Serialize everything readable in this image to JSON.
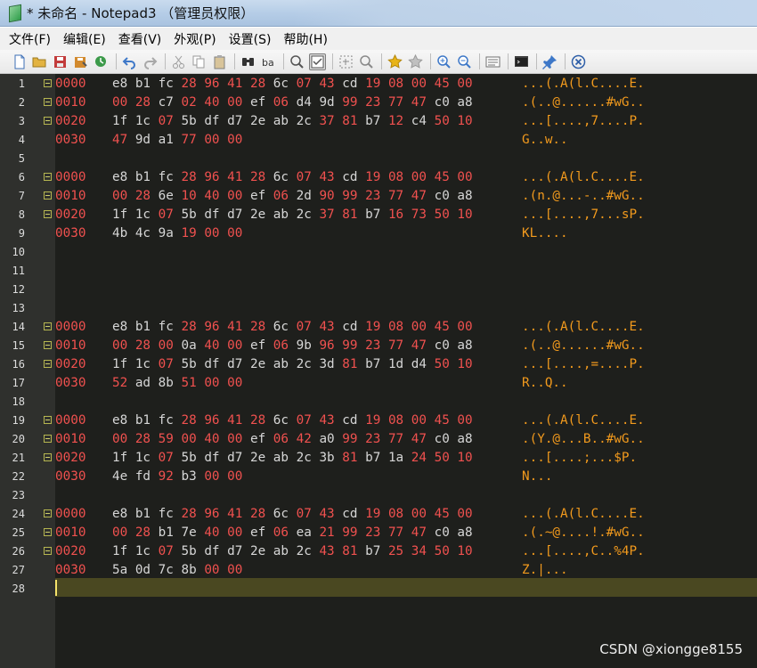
{
  "window": {
    "title": "* 未命名 - Notepad3 （管理员权限）"
  },
  "menu": [
    "文件(F)",
    "编辑(E)",
    "查看(V)",
    "外观(P)",
    "设置(S)",
    "帮助(H)"
  ],
  "toolbar": [
    {
      "name": "new-file-icon",
      "color": "#3d6fb6"
    },
    {
      "name": "open-folder-icon",
      "color": "#e3b341"
    },
    {
      "name": "save-icon",
      "color": "#c23b3b"
    },
    {
      "name": "save-as-icon",
      "color": "#d28a2e"
    },
    {
      "name": "browse-icon",
      "color": "#3c9a4a"
    },
    {
      "sep": true
    },
    {
      "name": "undo-icon",
      "color": "#3e78c8"
    },
    {
      "name": "redo-icon",
      "color": "#a8a8a8"
    },
    {
      "sep": true
    },
    {
      "name": "cut-icon",
      "color": "#9a9a9a"
    },
    {
      "name": "copy-icon",
      "color": "#9a9a9a"
    },
    {
      "name": "paste-icon",
      "color": "#7f7f7f"
    },
    {
      "sep": true
    },
    {
      "name": "find-icon",
      "color": "#333333"
    },
    {
      "name": "replace-icon",
      "color": "#333333"
    },
    {
      "sep": true
    },
    {
      "name": "goto-icon",
      "color": "#555555"
    },
    {
      "name": "word-wrap-icon",
      "color": "#555555",
      "pressed": true
    },
    {
      "sep": true
    },
    {
      "name": "select-icon",
      "color": "#8a8a8a"
    },
    {
      "name": "zoom-find-icon",
      "color": "#8a8a8a"
    },
    {
      "sep": true
    },
    {
      "name": "favorite-icon",
      "color": "#e8b417"
    },
    {
      "name": "add-favorite-icon",
      "color": "#c0c0c0"
    },
    {
      "sep": true
    },
    {
      "name": "zoom-in-icon",
      "color": "#3e78c8"
    },
    {
      "name": "zoom-out-icon",
      "color": "#3e78c8"
    },
    {
      "sep": true
    },
    {
      "name": "scheme-icon",
      "color": "#707070"
    },
    {
      "sep": true
    },
    {
      "name": "customize-icon",
      "color": "#404040"
    },
    {
      "sep": true
    },
    {
      "name": "pin-icon",
      "color": "#3e78c8"
    },
    {
      "sep": true
    },
    {
      "name": "exit-icon",
      "color": "#2f5fa8"
    }
  ],
  "editor": {
    "lines": [
      {
        "n": "1",
        "fold": true,
        "offset": "0000",
        "hex": "e8 b1 fc 28 96 41 28 6c 07 43 cd 19 08 00 45 00",
        "ascii": "...(.A(l.C....E."
      },
      {
        "n": "2",
        "fold": true,
        "offset": "0010",
        "hex": "00 28 c7 02 40 00 ef 06 d4 9d 99 23 77 47 c0 a8",
        "ascii": ".(..@......#wG.."
      },
      {
        "n": "3",
        "fold": true,
        "offset": "0020",
        "hex": "1f 1c 07 5b df d7 2e ab 2c 37 81 b7 12 c4 50 10",
        "ascii": "...[....,7....P."
      },
      {
        "n": "4",
        "fold": false,
        "offset": "0030",
        "hex": "47 9d a1 77 00 00",
        "ascii": "G..w.."
      },
      {
        "n": "5",
        "fold": false,
        "offset": "",
        "hex": "",
        "ascii": ""
      },
      {
        "n": "6",
        "fold": true,
        "offset": "0000",
        "hex": "e8 b1 fc 28 96 41 28 6c 07 43 cd 19 08 00 45 00",
        "ascii": "...(.A(l.C....E."
      },
      {
        "n": "7",
        "fold": true,
        "offset": "0010",
        "hex": "00 28 6e 10 40 00 ef 06 2d 90 99 23 77 47 c0 a8",
        "ascii": ".(n.@...-..#wG.."
      },
      {
        "n": "8",
        "fold": true,
        "offset": "0020",
        "hex": "1f 1c 07 5b df d7 2e ab 2c 37 81 b7 16 73 50 10",
        "ascii": "...[....,7...sP."
      },
      {
        "n": "9",
        "fold": false,
        "offset": "0030",
        "hex": "4b 4c 9a 19 00 00",
        "ascii": "KL...."
      },
      {
        "n": "10",
        "fold": false,
        "offset": "",
        "hex": "",
        "ascii": ""
      },
      {
        "n": "11",
        "fold": false,
        "offset": "",
        "hex": "",
        "ascii": ""
      },
      {
        "n": "12",
        "fold": false,
        "offset": "",
        "hex": "",
        "ascii": ""
      },
      {
        "n": "13",
        "fold": false,
        "offset": "",
        "hex": "",
        "ascii": ""
      },
      {
        "n": "14",
        "fold": true,
        "offset": "0000",
        "hex": "e8 b1 fc 28 96 41 28 6c 07 43 cd 19 08 00 45 00",
        "ascii": "...(.A(l.C....E."
      },
      {
        "n": "15",
        "fold": true,
        "offset": "0010",
        "hex": "00 28 00 0a 40 00 ef 06 9b 96 99 23 77 47 c0 a8",
        "ascii": ".(..@......#wG.."
      },
      {
        "n": "16",
        "fold": true,
        "offset": "0020",
        "hex": "1f 1c 07 5b df d7 2e ab 2c 3d 81 b7 1d d4 50 10",
        "ascii": "...[....,=....P."
      },
      {
        "n": "17",
        "fold": false,
        "offset": "0030",
        "hex": "52 ad 8b 51 00 00",
        "ascii": "R..Q.."
      },
      {
        "n": "18",
        "fold": false,
        "offset": "",
        "hex": "",
        "ascii": ""
      },
      {
        "n": "19",
        "fold": true,
        "offset": "0000",
        "hex": "e8 b1 fc 28 96 41 28 6c 07 43 cd 19 08 00 45 00",
        "ascii": "...(.A(l.C....E."
      },
      {
        "n": "20",
        "fold": true,
        "offset": "0010",
        "hex": "00 28 59 00 40 00 ef 06 42 a0 99 23 77 47 c0 a8",
        "ascii": ".(Y.@...B..#wG.."
      },
      {
        "n": "21",
        "fold": true,
        "offset": "0020",
        "hex": "1f 1c 07 5b df d7 2e ab 2c 3b 81 b7 1a 24 50 10",
        "ascii": "...[....;...$P."
      },
      {
        "n": "22",
        "fold": false,
        "offset": "0030",
        "hex": "4e fd 92 b3 00 00",
        "ascii": "N..."
      },
      {
        "n": "23",
        "fold": false,
        "offset": "",
        "hex": "",
        "ascii": ""
      },
      {
        "n": "24",
        "fold": true,
        "offset": "0000",
        "hex": "e8 b1 fc 28 96 41 28 6c 07 43 cd 19 08 00 45 00",
        "ascii": "...(.A(l.C....E."
      },
      {
        "n": "25",
        "fold": true,
        "offset": "0010",
        "hex": "00 28 b1 7e 40 00 ef 06 ea 21 99 23 77 47 c0 a8",
        "ascii": ".(.~@....!.#wG.."
      },
      {
        "n": "26",
        "fold": true,
        "offset": "0020",
        "hex": "1f 1c 07 5b df d7 2e ab 2c 43 81 b7 25 34 50 10",
        "ascii": "...[....,C..%4P."
      },
      {
        "n": "27",
        "fold": false,
        "offset": "0030",
        "hex": "5a 0d 7c 8b 00 00",
        "ascii": "Z.|..."
      },
      {
        "n": "28",
        "fold": false,
        "offset": "",
        "hex": "",
        "ascii": ""
      }
    ]
  },
  "watermark": "CSDN @xiongge8155"
}
